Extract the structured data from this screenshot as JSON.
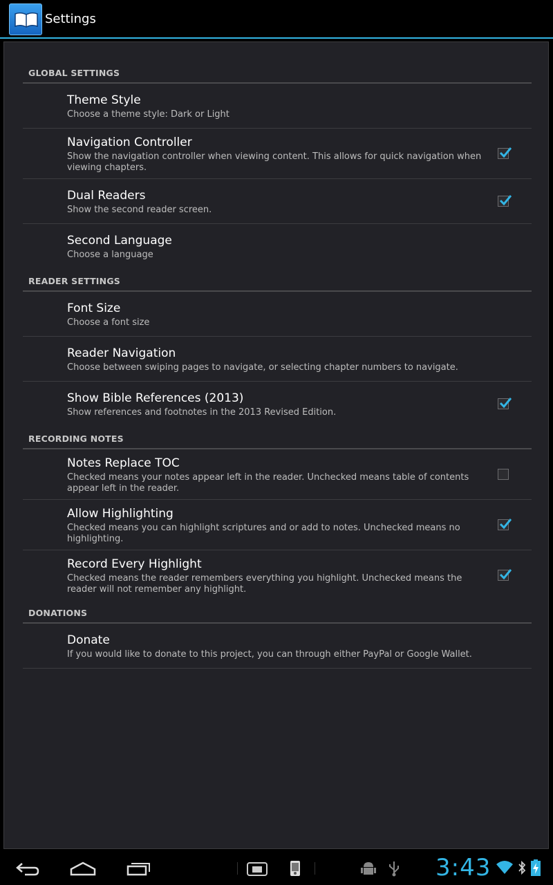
{
  "app": {
    "title": "Settings",
    "icon": "book-icon"
  },
  "categories": {
    "global": "GLOBAL SETTINGS",
    "reader": "READER SETTINGS",
    "recording": "RECORDING NOTES",
    "donations": "DONATIONS"
  },
  "prefs": {
    "theme": {
      "title": "Theme Style",
      "summary": "Choose a theme style: Dark or Light"
    },
    "navctl": {
      "title": "Navigation Controller",
      "summary": "Show the navigation controller when viewing content. This allows for quick navigation when viewing chapters.",
      "checked": true
    },
    "dual": {
      "title": "Dual Readers",
      "summary": "Show the second reader screen.",
      "checked": true
    },
    "lang": {
      "title": "Second Language",
      "summary": "Choose a language"
    },
    "font": {
      "title": "Font Size",
      "summary": "Choose a font size"
    },
    "readnav": {
      "title": "Reader Navigation",
      "summary": "Choose between swiping pages to navigate, or selecting chapter numbers to navigate."
    },
    "refs": {
      "title": "Show Bible References (2013)",
      "summary": "Show references and footnotes in the 2013 Revised Edition.",
      "checked": true
    },
    "toc": {
      "title": "Notes Replace TOC",
      "summary": "Checked means your notes appear left in the reader. Unchecked means table of contents appear left in the reader.",
      "checked": false
    },
    "highlight": {
      "title": "Allow Highlighting",
      "summary": "Checked means you can highlight scriptures and or add to notes. Unchecked means no highlighting.",
      "checked": true
    },
    "record": {
      "title": "Record Every Highlight",
      "summary": "Checked means the reader remembers everything you highlight. Unchecked means the reader will not remember any highlight.",
      "checked": true
    },
    "donate": {
      "title": "Donate",
      "summary": "If you would like to donate to this project, you can through either PayPal or Google Wallet."
    }
  },
  "status": {
    "time": "3:43"
  },
  "colors": {
    "accent": "#33b5e5",
    "background": "#222227"
  }
}
